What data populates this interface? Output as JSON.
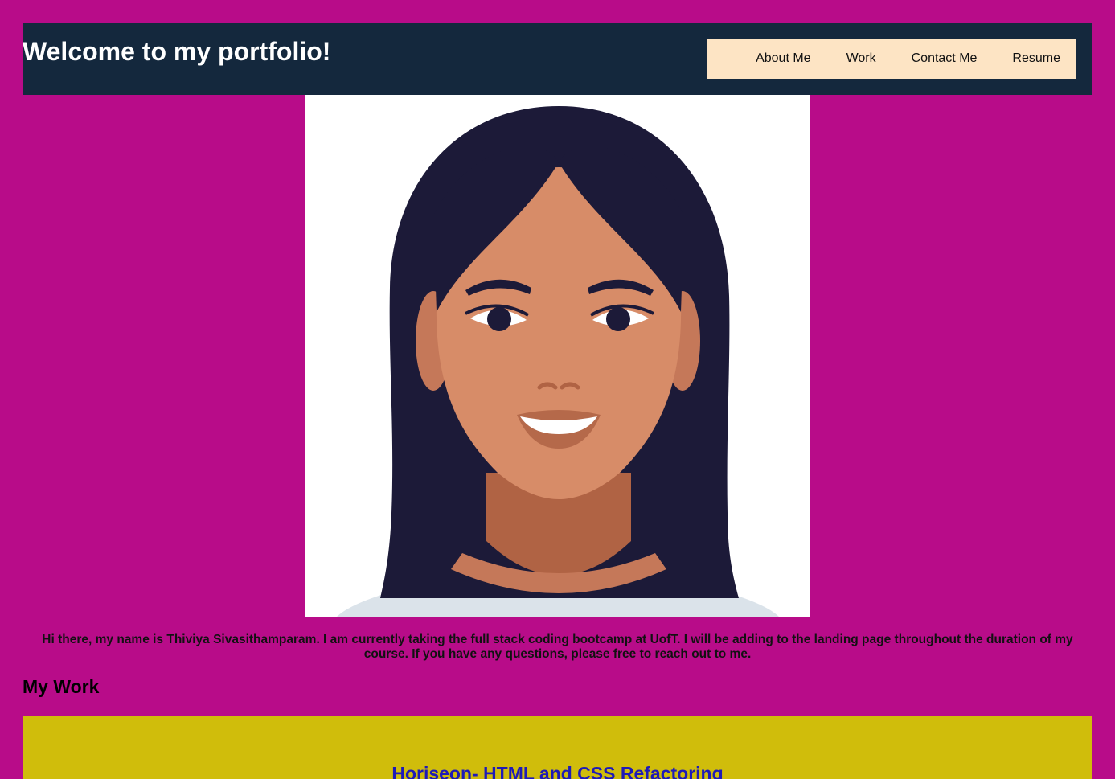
{
  "header": {
    "title": "Welcome to my portfolio!",
    "nav": [
      {
        "label": "About Me"
      },
      {
        "label": "Work"
      },
      {
        "label": "Contact Me"
      },
      {
        "label": "Resume"
      }
    ]
  },
  "about": {
    "intro": "Hi there, my name is Thiviya Sivasithamparam. I am currently taking the full stack coding bootcamp at UofT. I will be adding to the landing page throughout the duration of my course. If you have any questions, please free to reach out to me."
  },
  "work": {
    "heading": "My Work",
    "projects": [
      {
        "title": "Horiseon- HTML and CSS Refactoring"
      }
    ]
  },
  "colors": {
    "page_background": "#b80c89",
    "header_background": "#14283d",
    "nav_background": "#fde4c4",
    "project_card_background": "#d0bd0b",
    "project_link": "#1e1ab8"
  }
}
